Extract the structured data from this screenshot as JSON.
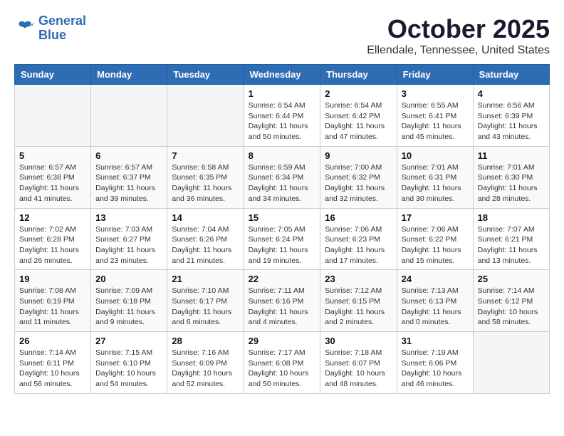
{
  "header": {
    "logo_line1": "General",
    "logo_line2": "Blue",
    "month_title": "October 2025",
    "location": "Ellendale, Tennessee, United States"
  },
  "weekdays": [
    "Sunday",
    "Monday",
    "Tuesday",
    "Wednesday",
    "Thursday",
    "Friday",
    "Saturday"
  ],
  "weeks": [
    [
      {
        "day": "",
        "info": ""
      },
      {
        "day": "",
        "info": ""
      },
      {
        "day": "",
        "info": ""
      },
      {
        "day": "1",
        "info": "Sunrise: 6:54 AM\nSunset: 6:44 PM\nDaylight: 11 hours\nand 50 minutes."
      },
      {
        "day": "2",
        "info": "Sunrise: 6:54 AM\nSunset: 6:42 PM\nDaylight: 11 hours\nand 47 minutes."
      },
      {
        "day": "3",
        "info": "Sunrise: 6:55 AM\nSunset: 6:41 PM\nDaylight: 11 hours\nand 45 minutes."
      },
      {
        "day": "4",
        "info": "Sunrise: 6:56 AM\nSunset: 6:39 PM\nDaylight: 11 hours\nand 43 minutes."
      }
    ],
    [
      {
        "day": "5",
        "info": "Sunrise: 6:57 AM\nSunset: 6:38 PM\nDaylight: 11 hours\nand 41 minutes."
      },
      {
        "day": "6",
        "info": "Sunrise: 6:57 AM\nSunset: 6:37 PM\nDaylight: 11 hours\nand 39 minutes."
      },
      {
        "day": "7",
        "info": "Sunrise: 6:58 AM\nSunset: 6:35 PM\nDaylight: 11 hours\nand 36 minutes."
      },
      {
        "day": "8",
        "info": "Sunrise: 6:59 AM\nSunset: 6:34 PM\nDaylight: 11 hours\nand 34 minutes."
      },
      {
        "day": "9",
        "info": "Sunrise: 7:00 AM\nSunset: 6:32 PM\nDaylight: 11 hours\nand 32 minutes."
      },
      {
        "day": "10",
        "info": "Sunrise: 7:01 AM\nSunset: 6:31 PM\nDaylight: 11 hours\nand 30 minutes."
      },
      {
        "day": "11",
        "info": "Sunrise: 7:01 AM\nSunset: 6:30 PM\nDaylight: 11 hours\nand 28 minutes."
      }
    ],
    [
      {
        "day": "12",
        "info": "Sunrise: 7:02 AM\nSunset: 6:28 PM\nDaylight: 11 hours\nand 26 minutes."
      },
      {
        "day": "13",
        "info": "Sunrise: 7:03 AM\nSunset: 6:27 PM\nDaylight: 11 hours\nand 23 minutes."
      },
      {
        "day": "14",
        "info": "Sunrise: 7:04 AM\nSunset: 6:26 PM\nDaylight: 11 hours\nand 21 minutes."
      },
      {
        "day": "15",
        "info": "Sunrise: 7:05 AM\nSunset: 6:24 PM\nDaylight: 11 hours\nand 19 minutes."
      },
      {
        "day": "16",
        "info": "Sunrise: 7:06 AM\nSunset: 6:23 PM\nDaylight: 11 hours\nand 17 minutes."
      },
      {
        "day": "17",
        "info": "Sunrise: 7:06 AM\nSunset: 6:22 PM\nDaylight: 11 hours\nand 15 minutes."
      },
      {
        "day": "18",
        "info": "Sunrise: 7:07 AM\nSunset: 6:21 PM\nDaylight: 11 hours\nand 13 minutes."
      }
    ],
    [
      {
        "day": "19",
        "info": "Sunrise: 7:08 AM\nSunset: 6:19 PM\nDaylight: 11 hours\nand 11 minutes."
      },
      {
        "day": "20",
        "info": "Sunrise: 7:09 AM\nSunset: 6:18 PM\nDaylight: 11 hours\nand 9 minutes."
      },
      {
        "day": "21",
        "info": "Sunrise: 7:10 AM\nSunset: 6:17 PM\nDaylight: 11 hours\nand 6 minutes."
      },
      {
        "day": "22",
        "info": "Sunrise: 7:11 AM\nSunset: 6:16 PM\nDaylight: 11 hours\nand 4 minutes."
      },
      {
        "day": "23",
        "info": "Sunrise: 7:12 AM\nSunset: 6:15 PM\nDaylight: 11 hours\nand 2 minutes."
      },
      {
        "day": "24",
        "info": "Sunrise: 7:13 AM\nSunset: 6:13 PM\nDaylight: 11 hours\nand 0 minutes."
      },
      {
        "day": "25",
        "info": "Sunrise: 7:14 AM\nSunset: 6:12 PM\nDaylight: 10 hours\nand 58 minutes."
      }
    ],
    [
      {
        "day": "26",
        "info": "Sunrise: 7:14 AM\nSunset: 6:11 PM\nDaylight: 10 hours\nand 56 minutes."
      },
      {
        "day": "27",
        "info": "Sunrise: 7:15 AM\nSunset: 6:10 PM\nDaylight: 10 hours\nand 54 minutes."
      },
      {
        "day": "28",
        "info": "Sunrise: 7:16 AM\nSunset: 6:09 PM\nDaylight: 10 hours\nand 52 minutes."
      },
      {
        "day": "29",
        "info": "Sunrise: 7:17 AM\nSunset: 6:08 PM\nDaylight: 10 hours\nand 50 minutes."
      },
      {
        "day": "30",
        "info": "Sunrise: 7:18 AM\nSunset: 6:07 PM\nDaylight: 10 hours\nand 48 minutes."
      },
      {
        "day": "31",
        "info": "Sunrise: 7:19 AM\nSunset: 6:06 PM\nDaylight: 10 hours\nand 46 minutes."
      },
      {
        "day": "",
        "info": ""
      }
    ]
  ]
}
